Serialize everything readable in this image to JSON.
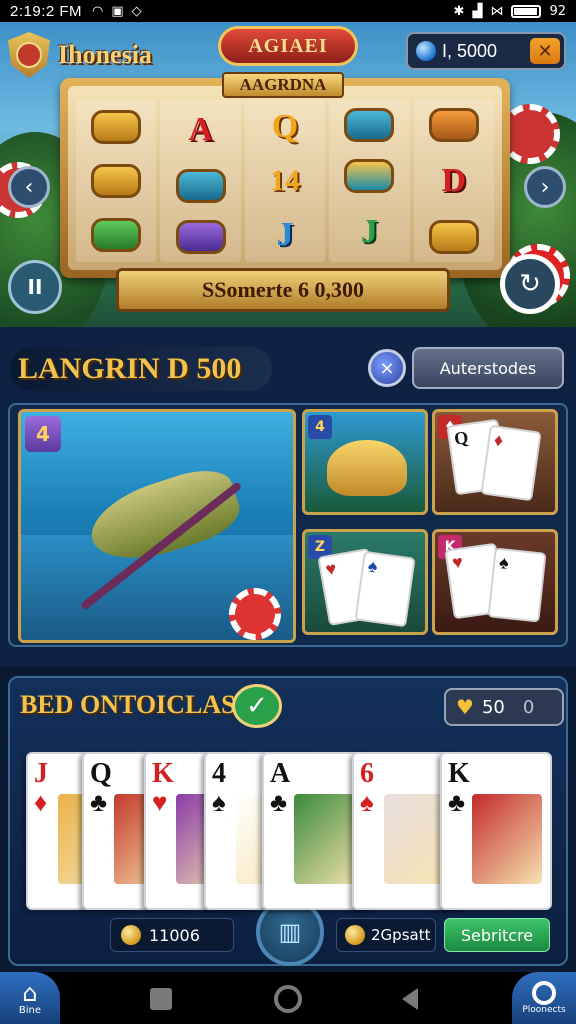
{
  "status_bar": {
    "time": "2:19:2 FM",
    "battery_text": "92",
    "battery_level": 0.92
  },
  "header": {
    "brand": "Ihonesia",
    "ribbon_title": "AGIAEI",
    "coin_amount": "I, 5000",
    "close_symbol": "✕"
  },
  "slot": {
    "title": "AAGRDNA",
    "reels": [
      [
        "pot-gold",
        "pot-gold",
        "pot-green"
      ],
      [
        "A",
        "pot-teal",
        "pot-purple"
      ],
      [
        "Q",
        "14",
        "J"
      ],
      [
        "pot-teal",
        "pot-teal",
        "J"
      ],
      [
        "pot-orange",
        "D",
        "pot-gold"
      ]
    ],
    "reel_letters": {
      "r1_top": "A",
      "r2_top": "Q",
      "r2_mid": "14",
      "r2_bot": "J",
      "r3_bot": "J",
      "r4_mid": "D"
    },
    "win_banner": "SSomerte 6 0,300"
  },
  "controls": {
    "prev_symbol": "‹",
    "next_symbol": "›",
    "pause_symbol": "II",
    "spin_symbol": "↻"
  },
  "games_section": {
    "label": "LANGRIN D 500",
    "globe_symbol": "⨯",
    "alt_button": "Auterstodes",
    "fishing_badge": "4",
    "tiles": [
      {
        "name": "shell",
        "tag": "4"
      },
      {
        "name": "cards-red",
        "tag": "♦"
      },
      {
        "name": "cards-blue",
        "tag": "Z"
      },
      {
        "name": "cards-pink",
        "tag": "K"
      }
    ]
  },
  "hand_section": {
    "title": "BED ONTOICLAS",
    "check_symbol": "✓",
    "bet_value": "50",
    "bet_sub": "0",
    "cards": [
      {
        "rank": "J",
        "suit": "♦",
        "color": "#d42020",
        "art": "#e9b24a"
      },
      {
        "rank": "Q",
        "suit": "♣",
        "color": "#111",
        "art": "#c43a2a"
      },
      {
        "rank": "K",
        "suit": "♥",
        "color": "#d42020",
        "art": "#8a3aa8"
      },
      {
        "rank": "4",
        "suit": "♠",
        "color": "#111",
        "art": "#ffffff"
      },
      {
        "rank": "A",
        "suit": "♣",
        "color": "#111",
        "art": "#3a8a3a"
      },
      {
        "rank": "6",
        "suit": "♠",
        "color": "#d42020",
        "art": "#e8dede"
      },
      {
        "rank": "K",
        "suit": "♣",
        "color": "#111",
        "art": "#c22a2a"
      }
    ],
    "chips": "11006",
    "center_symbol": "▥",
    "deposit": "2Gpsatt",
    "action_button": "Sebritcre"
  },
  "nav": {
    "home_label": "Bine",
    "profile_label": "Ploonects",
    "home_symbol": "⌂"
  },
  "colors": {
    "gold": "#f2c24a",
    "panel": "#0e2244",
    "action_green": "#2aa04a"
  }
}
